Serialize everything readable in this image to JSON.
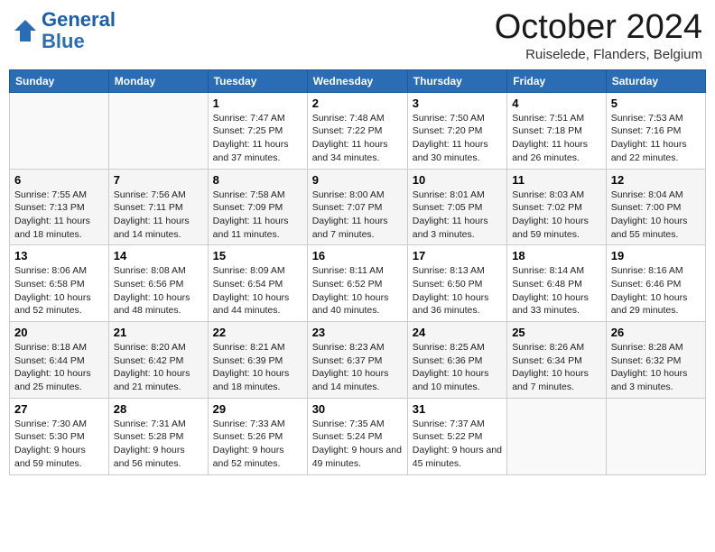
{
  "header": {
    "logo_line1": "General",
    "logo_line2": "Blue",
    "month": "October 2024",
    "location": "Ruiselede, Flanders, Belgium"
  },
  "days_of_week": [
    "Sunday",
    "Monday",
    "Tuesday",
    "Wednesday",
    "Thursday",
    "Friday",
    "Saturday"
  ],
  "weeks": [
    [
      {
        "day": "",
        "info": ""
      },
      {
        "day": "",
        "info": ""
      },
      {
        "day": "1",
        "info": "Sunrise: 7:47 AM\nSunset: 7:25 PM\nDaylight: 11 hours and 37 minutes."
      },
      {
        "day": "2",
        "info": "Sunrise: 7:48 AM\nSunset: 7:22 PM\nDaylight: 11 hours and 34 minutes."
      },
      {
        "day": "3",
        "info": "Sunrise: 7:50 AM\nSunset: 7:20 PM\nDaylight: 11 hours and 30 minutes."
      },
      {
        "day": "4",
        "info": "Sunrise: 7:51 AM\nSunset: 7:18 PM\nDaylight: 11 hours and 26 minutes."
      },
      {
        "day": "5",
        "info": "Sunrise: 7:53 AM\nSunset: 7:16 PM\nDaylight: 11 hours and 22 minutes."
      }
    ],
    [
      {
        "day": "6",
        "info": "Sunrise: 7:55 AM\nSunset: 7:13 PM\nDaylight: 11 hours and 18 minutes."
      },
      {
        "day": "7",
        "info": "Sunrise: 7:56 AM\nSunset: 7:11 PM\nDaylight: 11 hours and 14 minutes."
      },
      {
        "day": "8",
        "info": "Sunrise: 7:58 AM\nSunset: 7:09 PM\nDaylight: 11 hours and 11 minutes."
      },
      {
        "day": "9",
        "info": "Sunrise: 8:00 AM\nSunset: 7:07 PM\nDaylight: 11 hours and 7 minutes."
      },
      {
        "day": "10",
        "info": "Sunrise: 8:01 AM\nSunset: 7:05 PM\nDaylight: 11 hours and 3 minutes."
      },
      {
        "day": "11",
        "info": "Sunrise: 8:03 AM\nSunset: 7:02 PM\nDaylight: 10 hours and 59 minutes."
      },
      {
        "day": "12",
        "info": "Sunrise: 8:04 AM\nSunset: 7:00 PM\nDaylight: 10 hours and 55 minutes."
      }
    ],
    [
      {
        "day": "13",
        "info": "Sunrise: 8:06 AM\nSunset: 6:58 PM\nDaylight: 10 hours and 52 minutes."
      },
      {
        "day": "14",
        "info": "Sunrise: 8:08 AM\nSunset: 6:56 PM\nDaylight: 10 hours and 48 minutes."
      },
      {
        "day": "15",
        "info": "Sunrise: 8:09 AM\nSunset: 6:54 PM\nDaylight: 10 hours and 44 minutes."
      },
      {
        "day": "16",
        "info": "Sunrise: 8:11 AM\nSunset: 6:52 PM\nDaylight: 10 hours and 40 minutes."
      },
      {
        "day": "17",
        "info": "Sunrise: 8:13 AM\nSunset: 6:50 PM\nDaylight: 10 hours and 36 minutes."
      },
      {
        "day": "18",
        "info": "Sunrise: 8:14 AM\nSunset: 6:48 PM\nDaylight: 10 hours and 33 minutes."
      },
      {
        "day": "19",
        "info": "Sunrise: 8:16 AM\nSunset: 6:46 PM\nDaylight: 10 hours and 29 minutes."
      }
    ],
    [
      {
        "day": "20",
        "info": "Sunrise: 8:18 AM\nSunset: 6:44 PM\nDaylight: 10 hours and 25 minutes."
      },
      {
        "day": "21",
        "info": "Sunrise: 8:20 AM\nSunset: 6:42 PM\nDaylight: 10 hours and 21 minutes."
      },
      {
        "day": "22",
        "info": "Sunrise: 8:21 AM\nSunset: 6:39 PM\nDaylight: 10 hours and 18 minutes."
      },
      {
        "day": "23",
        "info": "Sunrise: 8:23 AM\nSunset: 6:37 PM\nDaylight: 10 hours and 14 minutes."
      },
      {
        "day": "24",
        "info": "Sunrise: 8:25 AM\nSunset: 6:36 PM\nDaylight: 10 hours and 10 minutes."
      },
      {
        "day": "25",
        "info": "Sunrise: 8:26 AM\nSunset: 6:34 PM\nDaylight: 10 hours and 7 minutes."
      },
      {
        "day": "26",
        "info": "Sunrise: 8:28 AM\nSunset: 6:32 PM\nDaylight: 10 hours and 3 minutes."
      }
    ],
    [
      {
        "day": "27",
        "info": "Sunrise: 7:30 AM\nSunset: 5:30 PM\nDaylight: 9 hours and 59 minutes."
      },
      {
        "day": "28",
        "info": "Sunrise: 7:31 AM\nSunset: 5:28 PM\nDaylight: 9 hours and 56 minutes."
      },
      {
        "day": "29",
        "info": "Sunrise: 7:33 AM\nSunset: 5:26 PM\nDaylight: 9 hours and 52 minutes."
      },
      {
        "day": "30",
        "info": "Sunrise: 7:35 AM\nSunset: 5:24 PM\nDaylight: 9 hours and 49 minutes."
      },
      {
        "day": "31",
        "info": "Sunrise: 7:37 AM\nSunset: 5:22 PM\nDaylight: 9 hours and 45 minutes."
      },
      {
        "day": "",
        "info": ""
      },
      {
        "day": "",
        "info": ""
      }
    ]
  ]
}
